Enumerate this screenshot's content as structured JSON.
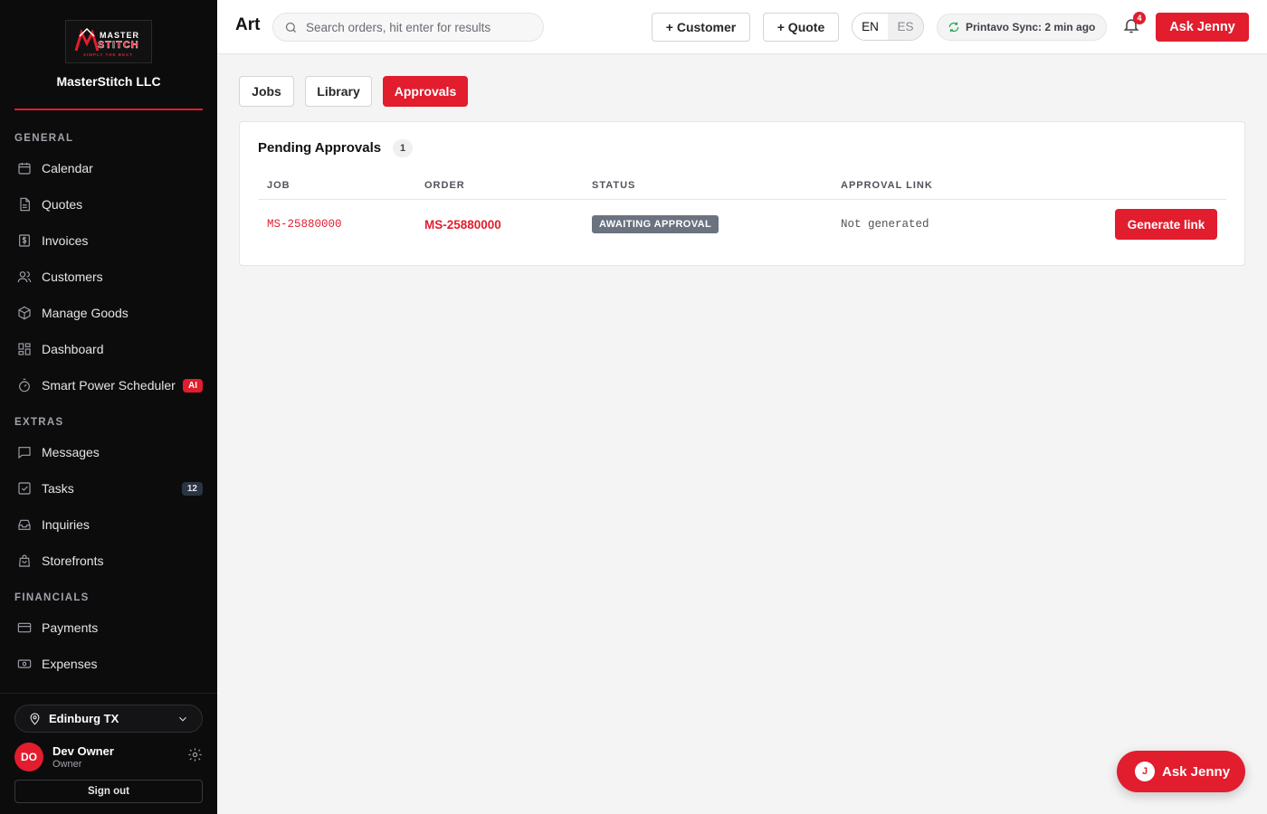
{
  "brand": {
    "logo_text_top": "MASTER",
    "logo_text_main": "STITCH",
    "logo_tagline": "SIMPLY THE BEST",
    "company_name": "MasterStitch LLC",
    "accent_color": "#e11d2e"
  },
  "sidebar": {
    "sections": {
      "general": "GENERAL",
      "extras": "EXTRAS",
      "financials": "FINANCIALS"
    },
    "general_items": [
      {
        "label": "Calendar",
        "icon": "calendar-icon"
      },
      {
        "label": "Quotes",
        "icon": "document-icon"
      },
      {
        "label": "Invoices",
        "icon": "dollar-icon"
      },
      {
        "label": "Customers",
        "icon": "users-icon"
      },
      {
        "label": "Manage Goods",
        "icon": "box-icon"
      },
      {
        "label": "Dashboard",
        "icon": "grid-icon"
      },
      {
        "label": "Smart Power Scheduler",
        "icon": "timer-icon",
        "badge": "AI"
      }
    ],
    "extras_items": [
      {
        "label": "Messages",
        "icon": "message-icon"
      },
      {
        "label": "Tasks",
        "icon": "checkbox-icon",
        "badge": "12"
      },
      {
        "label": "Inquiries",
        "icon": "inbox-icon"
      },
      {
        "label": "Storefronts",
        "icon": "store-icon"
      }
    ],
    "financials_items": [
      {
        "label": "Payments",
        "icon": "credit-card-icon"
      },
      {
        "label": "Expenses",
        "icon": "banknote-icon"
      }
    ],
    "location": "Edinburg TX",
    "user": {
      "initials": "DO",
      "name": "Dev Owner",
      "role": "Owner"
    },
    "signout_label": "Sign out"
  },
  "header": {
    "title": "Art",
    "search_placeholder": "Search orders, hit enter for results",
    "add_customer_label": "+ Customer",
    "add_quote_label": "+ Quote",
    "lang_en": "EN",
    "lang_es": "ES",
    "sync_status": "Printavo Sync: 2 min ago",
    "notifications_count": "4",
    "ask_jenny_label": "Ask Jenny"
  },
  "tabs": [
    {
      "label": "Jobs",
      "active": false
    },
    {
      "label": "Library",
      "active": false
    },
    {
      "label": "Approvals",
      "active": true
    }
  ],
  "approvals": {
    "title": "Pending Approvals",
    "count": "1",
    "columns": [
      "JOB",
      "ORDER",
      "STATUS",
      "APPROVAL LINK"
    ],
    "rows": [
      {
        "job": "MS-25880000",
        "order": "MS-25880000",
        "status": "AWAITING APPROVAL",
        "approval_link": "Not generated",
        "action_label": "Generate link"
      }
    ]
  },
  "floating": {
    "avatar_initial": "J",
    "label": "Ask Jenny"
  }
}
